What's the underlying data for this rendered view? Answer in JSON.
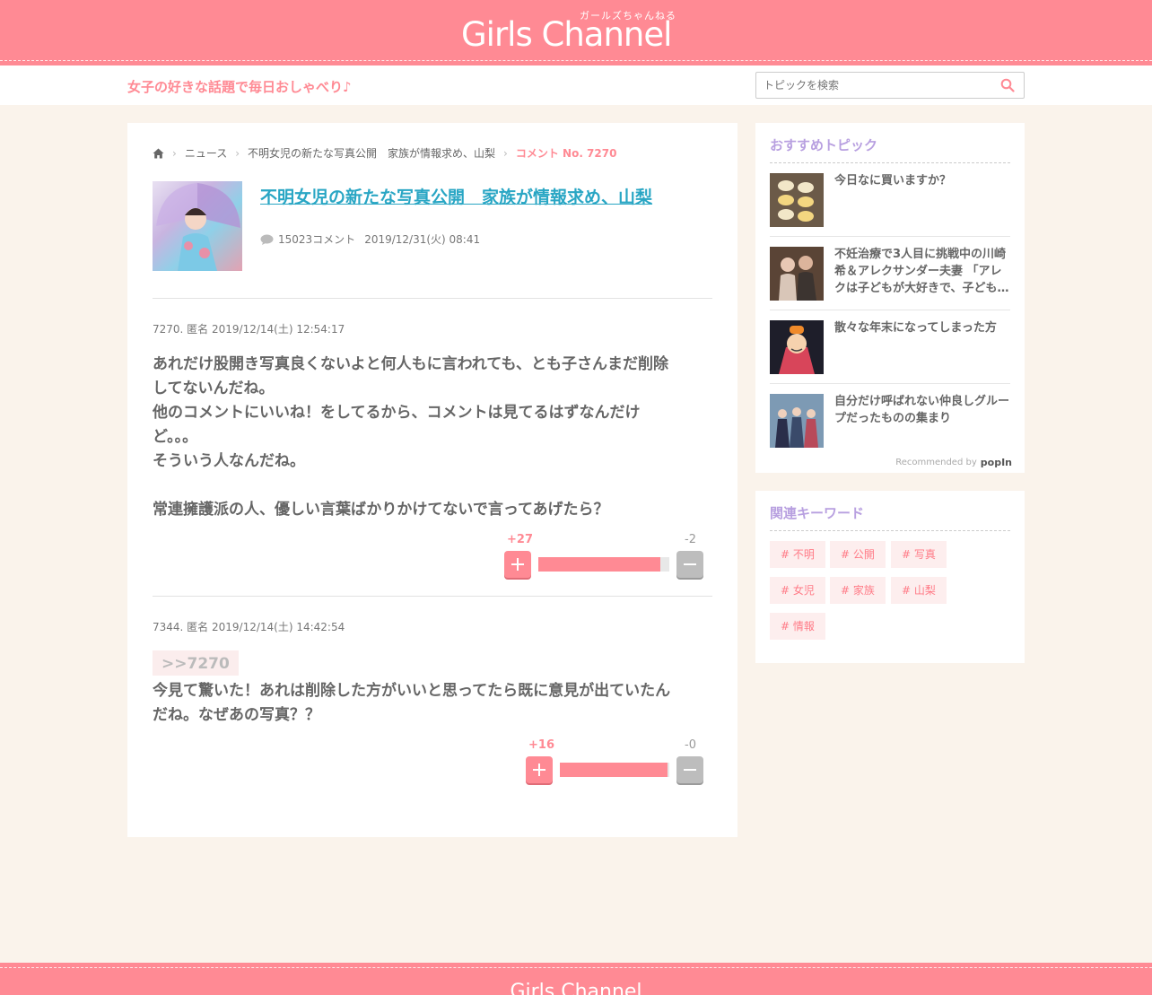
{
  "header": {
    "logo_sub": "ガールズちゃんねる",
    "logo": "Girls Channel",
    "tagline": "女子の好きな話題で毎日おしゃべり♪",
    "search_placeholder": "トピックを検索"
  },
  "breadcrumb": {
    "items": [
      "ニュース",
      "不明女児の新たな写真公開　家族が情報求め、山梨"
    ],
    "current": "コメント No. 7270"
  },
  "topic": {
    "title": "不明女児の新たな写真公開　家族が情報求め、山梨",
    "comment_count": "15023コメント",
    "date": "2019/12/31(火) 08:41"
  },
  "comments": [
    {
      "header": "7270. 匿名 2019/12/14(土) 12:54:17",
      "anchor": "",
      "body": "あれだけ股開き写真良くないよと何人もに言われても、とも子さんまだ削除\nしてないんだね。\n他のコメントにいいね！をしてるから、コメントは見てるはずなんだけ\nど。。。\nそういう人なんだね。\n\n常連擁護派の人、優しい言葉ばかりかけてないで言ってあげたら？",
      "plus": "+27",
      "minus": "-2",
      "plus_ratio": 0.93
    },
    {
      "header": "7344. 匿名 2019/12/14(土) 14:42:54",
      "anchor": ">>7270",
      "body": "今見て驚いた！あれは削除した方がいいと思ってたら既に意見が出ていたん\nだね。なぜあの写真？？",
      "plus": "+16",
      "minus": "-0",
      "plus_ratio": 0.98
    }
  ],
  "sidebar": {
    "recommended_title": "おすすめトピック",
    "recommended": [
      {
        "title": "今日なに買いますか？"
      },
      {
        "title": "不妊治療で3人目に挑戦中の川崎希＆アレクサンダー夫妻 「アレクは子どもが大好きで、子ども…"
      },
      {
        "title": "散々な年末になってしまった方"
      },
      {
        "title": "自分だけ呼ばれない仲良しグループだったものの集まり"
      }
    ],
    "recommended_by": "Recommended by",
    "popin": "popIn",
    "keywords_title": "関連キーワード",
    "keywords": [
      "# 不明",
      "# 公開",
      "# 写真",
      "# 女児",
      "# 家族",
      "# 山梨",
      "# 情報"
    ]
  },
  "footer": {
    "logo": "Girls Channel"
  }
}
